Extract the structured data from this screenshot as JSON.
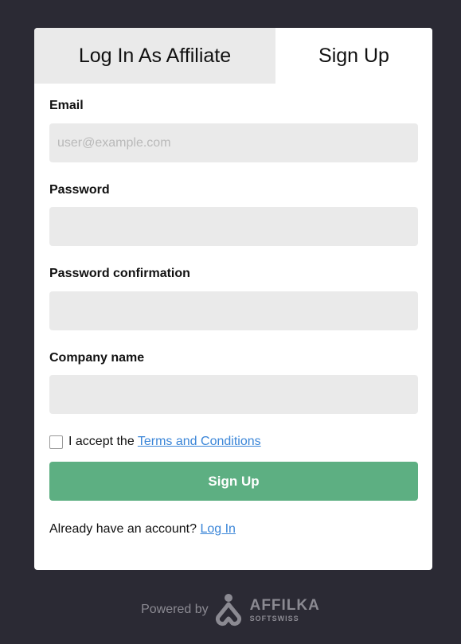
{
  "tabs": {
    "login": "Log In As Affiliate",
    "signup": "Sign Up"
  },
  "form": {
    "email": {
      "label": "Email",
      "placeholder": "user@example.com",
      "value": ""
    },
    "password": {
      "label": "Password",
      "placeholder": "",
      "value": ""
    },
    "password_confirmation": {
      "label": "Password confirmation",
      "placeholder": "",
      "value": ""
    },
    "company_name": {
      "label": "Company name",
      "placeholder": "",
      "value": ""
    },
    "terms": {
      "prefix": "I accept the",
      "link": "Terms and Conditions",
      "checked": false
    },
    "submit_label": "Sign Up",
    "already": {
      "text": "Already have an account?",
      "link": "Log In"
    }
  },
  "footer": {
    "powered_by": "Powered by",
    "brand_name": "AFFILKA",
    "brand_sub": "SOFTSWISS",
    "logo_icon": "affilka-logo-icon"
  },
  "colors": {
    "background": "#2b2a34",
    "card": "#ffffff",
    "inactive_tab": "#eaeaea",
    "input_bg": "#eaeaea",
    "primary_button": "#5daf82",
    "link": "#3b86d8",
    "footer_text": "#8b8a92"
  }
}
